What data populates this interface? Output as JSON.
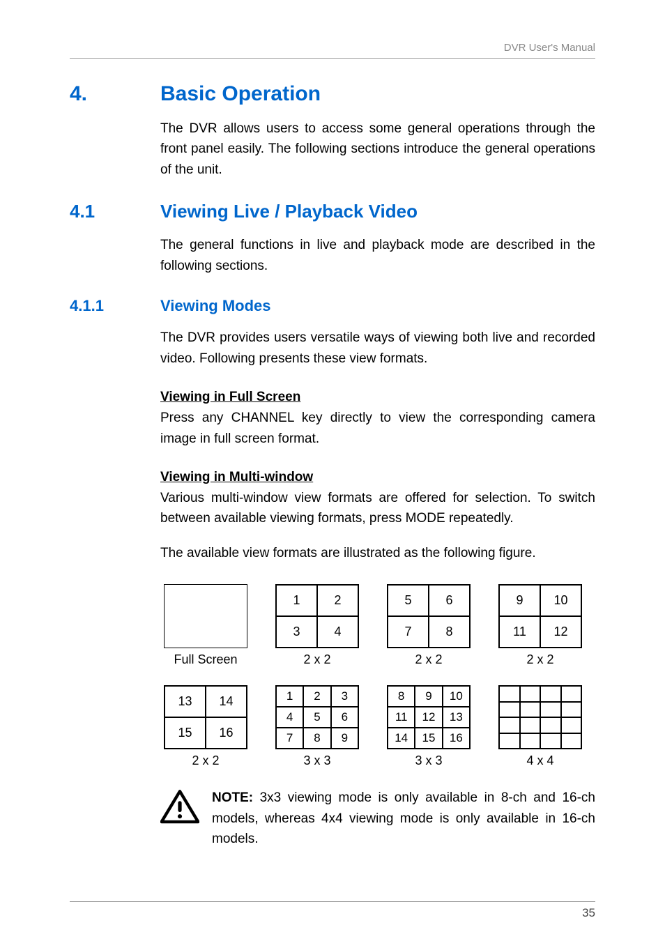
{
  "header": {
    "running": "DVR User's Manual"
  },
  "sec4": {
    "num": "4.",
    "title": "Basic Operation",
    "p1": "The DVR allows users to access some general operations through the front panel easily. The following sections introduce the general operations of the unit."
  },
  "sec41": {
    "num": "4.1",
    "title": "Viewing Live / Playback Video",
    "p1": "The general functions in live and playback mode are described in the following sections."
  },
  "sec411": {
    "num": "4.1.1",
    "title": "Viewing Modes",
    "p1": "The DVR provides users versatile ways of viewing both live and recorded video. Following presents these view formats.",
    "full_h": "Viewing in Full Screen",
    "full_p": "Press any CHANNEL key directly to view the corresponding camera image in full screen format.",
    "multi_h": "Viewing in Multi-window",
    "multi_p1": "Various multi-window view formats are offered for selection. To switch between available viewing formats, press MODE repeatedly.",
    "multi_p2": "The available view formats are illustrated as the following figure."
  },
  "figures": {
    "row1": {
      "b1": {
        "label": "Full Screen"
      },
      "b2": {
        "label": "2 x 2",
        "cells": [
          "1",
          "2",
          "3",
          "4"
        ]
      },
      "b3": {
        "label": "2 x 2",
        "cells": [
          "5",
          "6",
          "7",
          "8"
        ]
      },
      "b4": {
        "label": "2 x 2",
        "cells": [
          "9",
          "10",
          "11",
          "12"
        ]
      }
    },
    "row2": {
      "b1": {
        "label": "2 x 2",
        "cells": [
          "13",
          "14",
          "15",
          "16"
        ]
      },
      "b2": {
        "label": "3 x 3",
        "cells": [
          "1",
          "2",
          "3",
          "4",
          "5",
          "6",
          "7",
          "8",
          "9"
        ]
      },
      "b3": {
        "label": "3 x 3",
        "cells": [
          "8",
          "9",
          "10",
          "11",
          "12",
          "13",
          "14",
          "15",
          "16"
        ]
      },
      "b4": {
        "label": "4 x 4"
      }
    }
  },
  "note": {
    "bold": "NOTE:",
    "text": " 3x3 viewing mode is only available in 8-ch and 16-ch models, whereas 4x4 viewing mode is only available in 16-ch models."
  },
  "page_number": "35"
}
